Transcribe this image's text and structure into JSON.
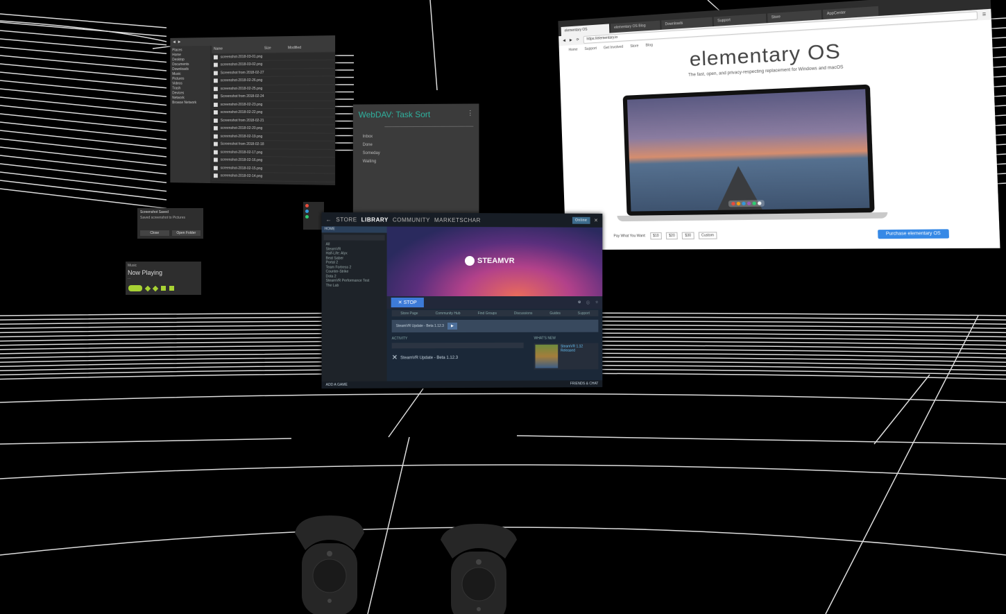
{
  "file_manager": {
    "sidebar": [
      "Places",
      "Home",
      "Desktop",
      "Documents",
      "Downloads",
      "Music",
      "Pictures",
      "Videos",
      "Trash",
      "Devices",
      "Network",
      "Browse Network"
    ],
    "header": [
      "Name",
      "Size",
      "Modified"
    ],
    "rows": [
      "screenshot-2018-03-01.png",
      "screenshot-2018-03-02.png",
      "Screenshot from 2018-02-27",
      "screenshot-2018-02-26.png",
      "screenshot-2018-02-25.png",
      "Screenshot from 2018-02-24",
      "screenshot-2018-02-23.png",
      "screenshot-2018-02-22.png",
      "Screenshot from 2018-02-21",
      "screenshot-2018-02-20.png",
      "screenshot-2018-02-19.png",
      "Screenshot from 2018-02-18",
      "screenshot-2018-02-17.png",
      "screenshot-2018-02-16.png",
      "screenshot-2018-02-15.png",
      "screenshot-2018-02-14.png"
    ]
  },
  "webdav": {
    "title": "WebDAV: Task Sort",
    "items": [
      "Inbox",
      "Done",
      "Someday",
      "Waiting"
    ]
  },
  "popup": {
    "title": "Screenshot Saved",
    "body": "Saved screenshot to Pictures",
    "buttons": [
      "Close",
      "Open Folder"
    ]
  },
  "now_playing": {
    "app": "Music",
    "title": "Now Playing",
    "sub": "..."
  },
  "browser": {
    "tabs": [
      "elementary OS",
      "elementary OS Blog",
      "Downloads",
      "Support",
      "Store",
      "AppCenter"
    ],
    "url": "https://elementary.io",
    "nav": [
      "Home",
      "Support",
      "Get Involved",
      "Store",
      "Blog"
    ],
    "heading": "elementary OS",
    "tagline": "The fast, open, and privacy-respecting replacement for Windows and macOS",
    "pay_label": "Pay What You Want:",
    "amounts": [
      "$10",
      "$20",
      "$30",
      "Custom"
    ],
    "download": "Purchase elementary OS"
  },
  "steam": {
    "nav": [
      "STORE",
      "LIBRARY",
      "COMMUNITY",
      "MARKETSCHAR"
    ],
    "active_nav": "LIBRARY",
    "account": "Online",
    "home": "HOME",
    "games": [
      "All",
      "SteamVR",
      "Half-Life: Alyx",
      "Beat Saber",
      "Portal 2",
      "Team Fortress 2",
      "Counter-Strike",
      "Dota 2",
      "SteamVR Performance Test",
      "The Lab"
    ],
    "hero_title": "STEAMVR",
    "stop": "STOP",
    "subnav": [
      "Store Page",
      "Community Hub",
      "Find Groups",
      "Discussions",
      "Guides",
      "Support"
    ],
    "activity": "ACTIVITY",
    "update": "SteamVR Update - Beta 1.12.3",
    "news": "WHAT'S NEW",
    "news_item": "SteamVR 1.12 Released",
    "footer": "ADD A GAME",
    "friends": "FRIENDS & CHAT"
  }
}
